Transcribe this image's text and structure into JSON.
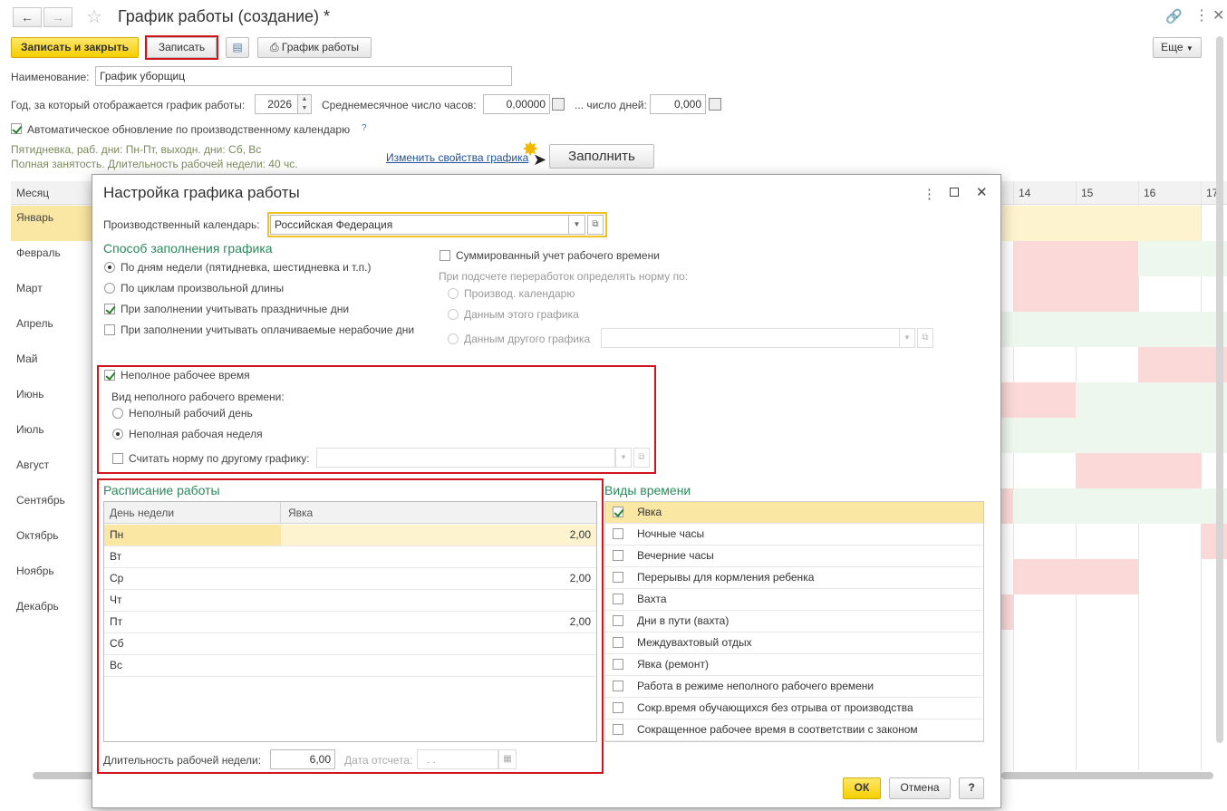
{
  "window": {
    "title": "График работы (создание) *",
    "toolbar": {
      "save_close": "Записать и закрыть",
      "save": "Записать",
      "schedule": "График работы",
      "more": "Еще"
    },
    "name_label": "Наименование:",
    "name_value": "График уборщиц",
    "year_label": "Год, за который отображается график работы:",
    "year_value": "2026",
    "avg_hours_label": "Среднемесячное число часов:",
    "avg_hours_value": "0,00000",
    "days_label": "... число дней:",
    "days_value": "0,000",
    "auto_update_label": "Автоматическое обновление по производственному календарю",
    "auto_update_help": "?",
    "info_line1": "Пятидневка, раб. дни: Пн-Пт, выходн. дни: Сб, Вс",
    "info_line2": "Полная занятость. Длительность рабочей недели: 40 чс.",
    "change_link": "Изменить свойства графика",
    "fill_button": "Заполнить",
    "grid": {
      "month_header": "Месяц",
      "day_headers": [
        "14",
        "15",
        "16",
        "17"
      ],
      "months": [
        "Январь",
        "Февраль",
        "Март",
        "Апрель",
        "Май",
        "Июнь",
        "Июль",
        "Август",
        "Сентябрь",
        "Октябрь",
        "Ноябрь",
        "Декабрь"
      ]
    }
  },
  "dialog": {
    "title": "Настройка графика работы",
    "calendar_label": "Производственный календарь:",
    "calendar_value": "Российская Федерация",
    "fill_method_header": "Способ заполнения графика",
    "fill_by_weekdays": "По дням недели (пятидневка, шестидневка и т.п.)",
    "fill_by_cycles": "По циклам произвольной длины",
    "consider_holidays": "При заполнении учитывать праздничные дни",
    "consider_paid_nonworking": "При заполнении учитывать оплачиваемые нерабочие дни",
    "summarized_label": "Суммированный учет рабочего времени",
    "overtime_norm_label": "При подсчете переработок определять норму по:",
    "norm_prod_calendar": "Производ. календарю",
    "norm_this_schedule": "Данным этого графика",
    "norm_other_schedule": "Данным другого графика",
    "part_time_label": "Неполное рабочее время",
    "part_time_kind_label": "Вид неполного рабочего времени:",
    "part_day": "Неполный рабочий день",
    "part_week": "Неполная рабочая неделя",
    "norm_other_label": "Считать норму по другому графику:",
    "schedule_header": "Расписание работы",
    "schedule_columns": [
      "День недели",
      "Явка"
    ],
    "schedule_rows": [
      {
        "day": "Пн",
        "value": "2,00"
      },
      {
        "day": "Вт",
        "value": ""
      },
      {
        "day": "Ср",
        "value": "2,00"
      },
      {
        "day": "Чт",
        "value": ""
      },
      {
        "day": "Пт",
        "value": "2,00"
      },
      {
        "day": "Сб",
        "value": ""
      },
      {
        "day": "Вс",
        "value": ""
      }
    ],
    "week_duration_label": "Длительность рабочей недели:",
    "week_duration_value": "6,00",
    "ref_date_label": "Дата отсчета:",
    "ref_date_value": ". .",
    "time_types_header": "Виды времени",
    "time_types": [
      {
        "label": "Явка",
        "checked": true
      },
      {
        "label": "Ночные часы",
        "checked": false
      },
      {
        "label": "Вечерние часы",
        "checked": false
      },
      {
        "label": "Перерывы для кормления ребенка",
        "checked": false
      },
      {
        "label": "Вахта",
        "checked": false
      },
      {
        "label": "Дни в пути (вахта)",
        "checked": false
      },
      {
        "label": "Междувахтовый отдых",
        "checked": false
      },
      {
        "label": "Явка (ремонт)",
        "checked": false
      },
      {
        "label": "Работа в режиме неполного рабочего времени",
        "checked": false
      },
      {
        "label": "Сокр.время обучающихся без отрыва от производства",
        "checked": false
      },
      {
        "label": "Сокращенное рабочее время в соответствии с законом",
        "checked": false
      }
    ],
    "ok": "ОК",
    "cancel": "Отмена",
    "help": "?"
  },
  "colors": {
    "accent_yellow": "#f5cf00",
    "highlight_red": "#d2141c",
    "section_green": "#2b8a5b",
    "row_selected": "#fbe7a4"
  }
}
